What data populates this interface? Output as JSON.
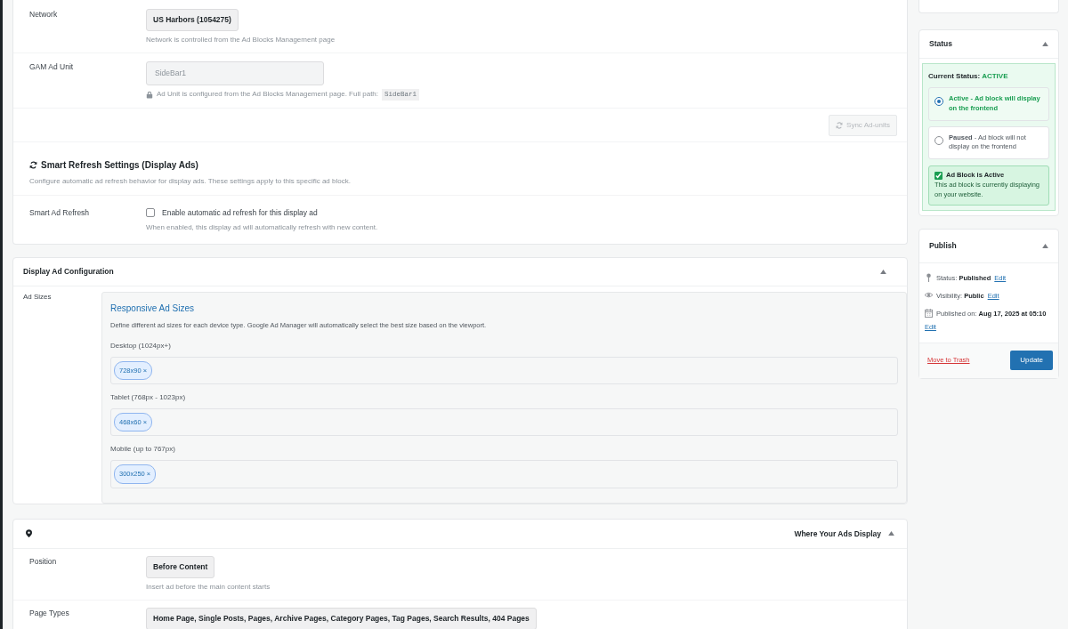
{
  "settings": {
    "rows": [
      {
        "kind": "pill",
        "label": "Network",
        "value": "US Harbors (1054275)",
        "help": "Network is controlled from the Ad Blocks Management page"
      },
      {
        "kind": "input",
        "label": "GAM Ad Unit",
        "value": "SideBar1",
        "help": "Ad Unit is configured from the Ad Blocks Management page. Full path:",
        "help_code": "SideBar1"
      }
    ],
    "sync_button": {
      "label": "Sync Ad-units",
      "disabled": true
    },
    "refresh": {
      "title": "Smart Refresh Settings (Display Ads)",
      "description": "Configure automatic ad refresh behavior for display ads. These settings apply to this specific ad block.",
      "label": "Smart Ad Refresh",
      "checkbox_label": "Enable automatic ad refresh for this display ad",
      "checked": false,
      "help": "When enabled, this display ad will automatically refresh with new content."
    }
  },
  "display_config": {
    "title": "Display Ad Configuration",
    "expanded": true,
    "label": "Ad Sizes",
    "heading": "Responsive Ad Sizes",
    "description": "Define different ad sizes for each device type. Google Ad Manager will automatically select the best size based on the viewport.",
    "devices": [
      {
        "label": "Desktop (1024px+)",
        "sizes": [
          {
            "label": "728x90",
            "remove": "×"
          }
        ]
      },
      {
        "label": "Tablet (768px - 1023px)",
        "sizes": [
          {
            "label": "468x60",
            "remove": "×"
          }
        ]
      },
      {
        "label": "Mobile (up to 767px)",
        "sizes": [
          {
            "label": "300x250",
            "remove": "×"
          }
        ]
      }
    ]
  },
  "placement": {
    "title": "Where Your Ads Display",
    "expanded": true,
    "rows": [
      {
        "label": "Position",
        "value": "Before Content",
        "help": "Insert ad before the main content starts"
      },
      {
        "label": "Page Types",
        "value": "Home Page, Single Posts, Pages, Archive Pages, Category Pages, Tag Pages, Search Results, 404 Pages"
      }
    ]
  },
  "status": {
    "title": "Status",
    "expanded": true,
    "current_label": "Current Status:",
    "current_value": "ACTIVE",
    "options": [
      {
        "text": "**Active** - Ad block will display on the frontend",
        "selected": true
      },
      {
        "text": "**Paused** - Ad block will not display on the frontend",
        "selected": false
      }
    ],
    "notice_title": "Ad Block is Active",
    "notice_text": "This ad block is currently displaying on your website."
  },
  "publish": {
    "title": "Publish",
    "expanded": true,
    "items": [
      {
        "kind": "pin",
        "label": "Status:",
        "value": "Published",
        "link": "Edit"
      },
      {
        "kind": "eye",
        "label": "Visibility:",
        "value": "Public",
        "link": "Edit"
      },
      {
        "kind": "calendar",
        "label": "Published on:",
        "value": "Aug 17, 2025 at 05:10",
        "link": "Edit"
      }
    ],
    "trash": "Move to Trash",
    "update": "Update"
  }
}
